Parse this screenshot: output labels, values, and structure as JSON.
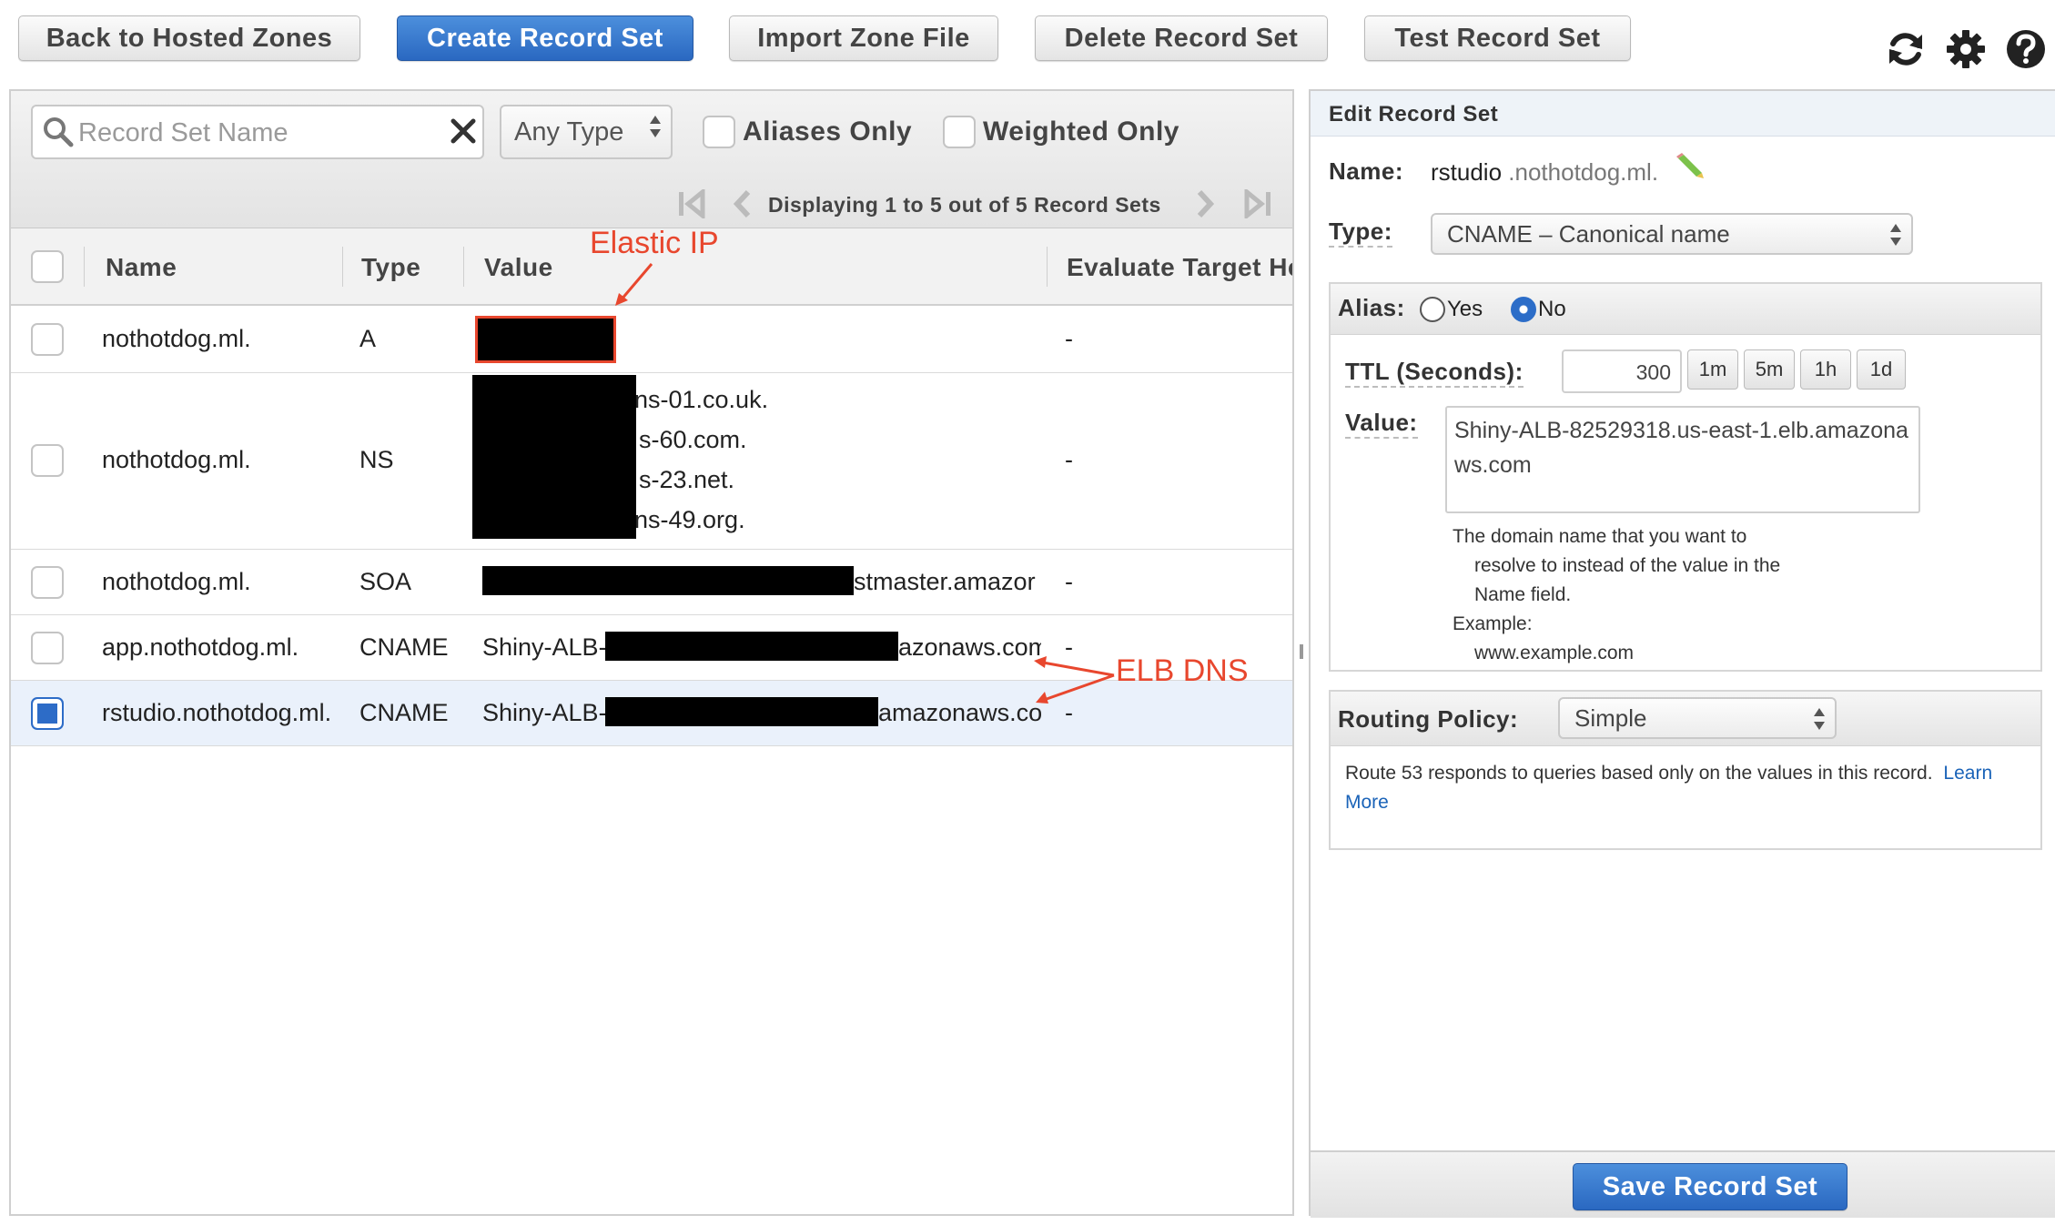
{
  "toolbar": {
    "back_label": "Back to Hosted Zones",
    "create_label": "Create Record Set",
    "import_label": "Import Zone File",
    "delete_label": "Delete Record Set",
    "test_label": "Test Record Set",
    "icons": [
      "refresh-icon",
      "gear-icon",
      "help-icon"
    ]
  },
  "filters": {
    "search_placeholder": "Record Set Name",
    "type_value": "Any Type",
    "aliases_only": "Aliases Only",
    "weighted_only": "Weighted Only",
    "pager_text": "Displaying 1 to 5 out of 5 Record Sets"
  },
  "table": {
    "columns": [
      "Name",
      "Type",
      "Value",
      "Evaluate Target He"
    ],
    "rows": [
      {
        "name": "nothotdog.ml.",
        "type": "A",
        "value_lines": [],
        "evaluate": "-"
      },
      {
        "name": "nothotdog.ml.",
        "type": "NS",
        "value_lines": [
          "ns-01.co.uk.",
          "s-60.com.",
          "s-23.net.",
          "ns-49.org."
        ],
        "evaluate": "-"
      },
      {
        "name": "nothotdog.ml.",
        "type": "SOA",
        "value_prefix": "",
        "value_suffix": "stmaster.amazor",
        "evaluate": "-"
      },
      {
        "name": "app.nothotdog.ml.",
        "type": "CNAME",
        "value_prefix": "Shiny-ALB-",
        "value_suffix": "azonaws.com",
        "evaluate": "-"
      },
      {
        "name": "rstudio.nothotdog.ml.",
        "type": "CNAME",
        "value_prefix": "Shiny-ALB-",
        "value_suffix": "amazonaws.com",
        "evaluate": "-",
        "selected": true
      }
    ]
  },
  "annotations": {
    "elastic_ip": "Elastic IP",
    "elb_dns": "ELB DNS"
  },
  "editor": {
    "header": "Edit Record Set",
    "name_label": "Name:",
    "name_value": "rstudio",
    "name_domain": ".nothotdog.ml.",
    "type_label": "Type:",
    "type_value": "CNAME – Canonical name",
    "alias_label": "Alias:",
    "alias_yes": "Yes",
    "alias_no": "No",
    "ttl_label": "TTL (Seconds):",
    "ttl_value": "300",
    "ttl_buttons": [
      "1m",
      "5m",
      "1h",
      "1d"
    ],
    "value_label": "Value:",
    "value_text": "Shiny-ALB-82529318.us-east-1.elb.amazonaws.com",
    "help_line1": "The domain name that you want to",
    "help_line2": "resolve to instead of the value in the",
    "help_line3": "Name field.",
    "help_example_label": "Example:",
    "help_example_value": "www.example.com",
    "routing_label": "Routing Policy:",
    "routing_value": "Simple",
    "routing_help": "Route 53 responds to queries based only on the values in this record.",
    "learn_more": "Learn More",
    "save_label": "Save Record Set"
  },
  "colors": {
    "primary": "#2a68c1",
    "annotation": "#e8472e",
    "link": "#1a63b8"
  }
}
